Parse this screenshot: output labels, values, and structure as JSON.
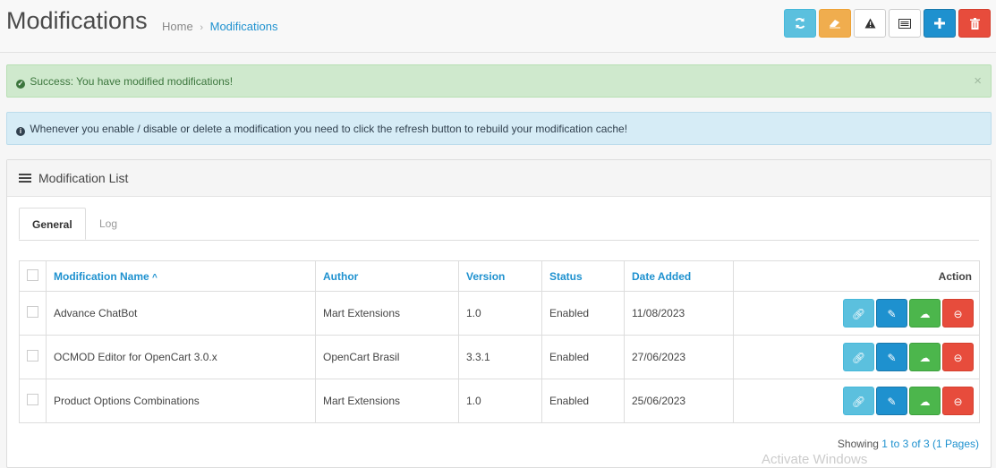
{
  "header": {
    "title": "Modifications",
    "breadcrumb": {
      "home": "Home",
      "separator": "›",
      "current": "Modifications"
    }
  },
  "toolbar": {
    "refresh_icon": "refresh-icon",
    "clear_icon": "eraser-icon",
    "warning_icon": "warning-icon",
    "log_icon": "list-alt-icon",
    "add_icon": "plus-icon",
    "delete_icon": "trash-icon"
  },
  "alerts": {
    "success": "Success: You have modified modifications!",
    "close": "×",
    "info": "Whenever you enable / disable or delete a modification you need to click the refresh button to rebuild your modification cache!"
  },
  "panel": {
    "title": "Modification List",
    "tabs": [
      {
        "label": "General"
      },
      {
        "label": "Log"
      }
    ]
  },
  "table": {
    "columns": {
      "name": "Modification Name",
      "sort_indicator": "^",
      "author": "Author",
      "version": "Version",
      "status": "Status",
      "date_added": "Date Added",
      "action": "Action"
    },
    "rows": [
      {
        "name": "Advance ChatBot",
        "author": "Mart Extensions",
        "version": "1.0",
        "status": "Enabled",
        "date_added": "11/08/2023"
      },
      {
        "name": "OCMOD Editor for OpenCart 3.0.x",
        "author": "OpenCart Brasil",
        "version": "3.3.1",
        "status": "Enabled",
        "date_added": "27/06/2023"
      },
      {
        "name": "Product Options Combinations",
        "author": "Mart Extensions",
        "version": "1.0",
        "status": "Enabled",
        "date_added": "25/06/2023"
      }
    ]
  },
  "pagination": {
    "prefix": "Showing",
    "range": "1 to 3 of 3 (1 Pages)"
  },
  "watermark": "Activate Windows",
  "colors": {
    "primary": "#1e91cf",
    "info": "#5bc0de",
    "warning": "#f0ad4e",
    "success": "#4cb64c",
    "danger": "#e74c3c"
  }
}
